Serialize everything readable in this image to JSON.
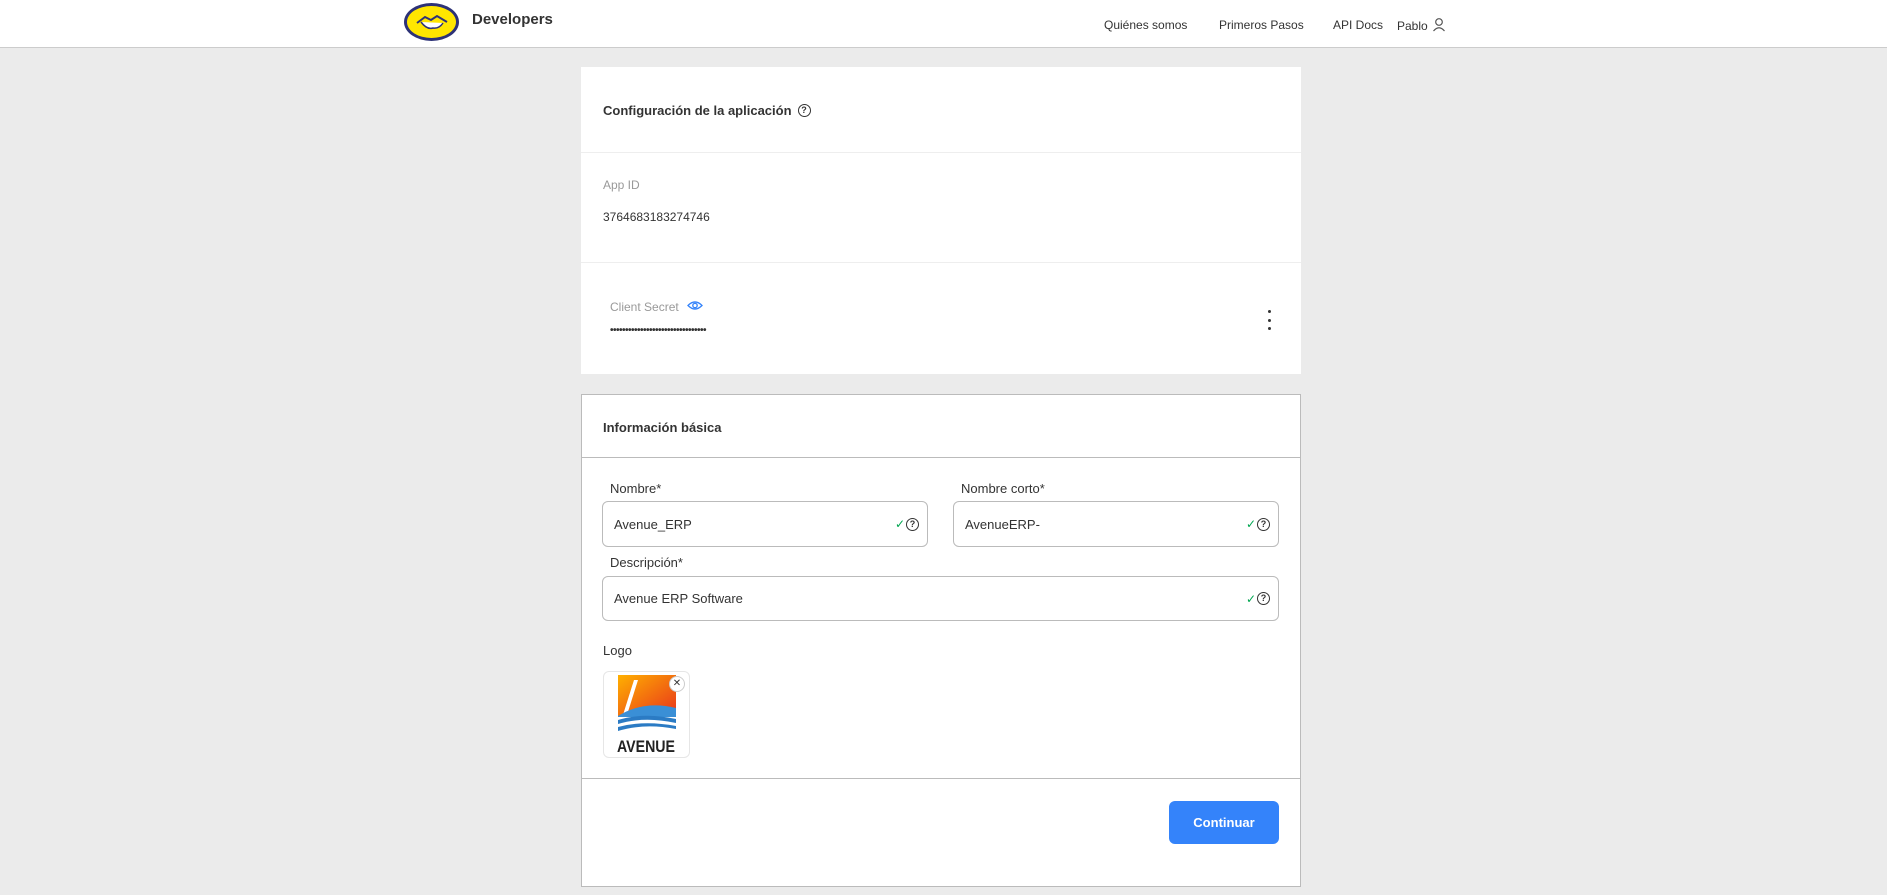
{
  "header": {
    "brand": "Developers",
    "nav": [
      "Quiénes somos",
      "Primeros Pasos",
      "API Docs"
    ],
    "user": "Pablo"
  },
  "config": {
    "title": "Configuración de la aplicación",
    "app_id_label": "App ID",
    "app_id_value": "3764683183274746",
    "client_secret_label": "Client Secret",
    "client_secret_value": "••••••••••••••••••••••••••••••••"
  },
  "info": {
    "title": "Información básica",
    "name_label": "Nombre*",
    "name_value": "Avenue_ERP",
    "short_name_label": "Nombre corto*",
    "short_name_value": "AvenueERP-",
    "description_label": "Descripción*",
    "description_value": "Avenue ERP Software",
    "logo_label": "Logo",
    "logo_text": "AVENUE",
    "continue_label": "Continuar"
  },
  "icons": {
    "check": "check-icon",
    "help": "help-icon",
    "eye": "eye-icon",
    "user": "user-icon",
    "menu": "more-vertical-icon"
  },
  "colors": {
    "accent": "#3483fa",
    "brand_yellow": "#ffe600",
    "success": "#00a650",
    "background": "#ebebeb"
  }
}
